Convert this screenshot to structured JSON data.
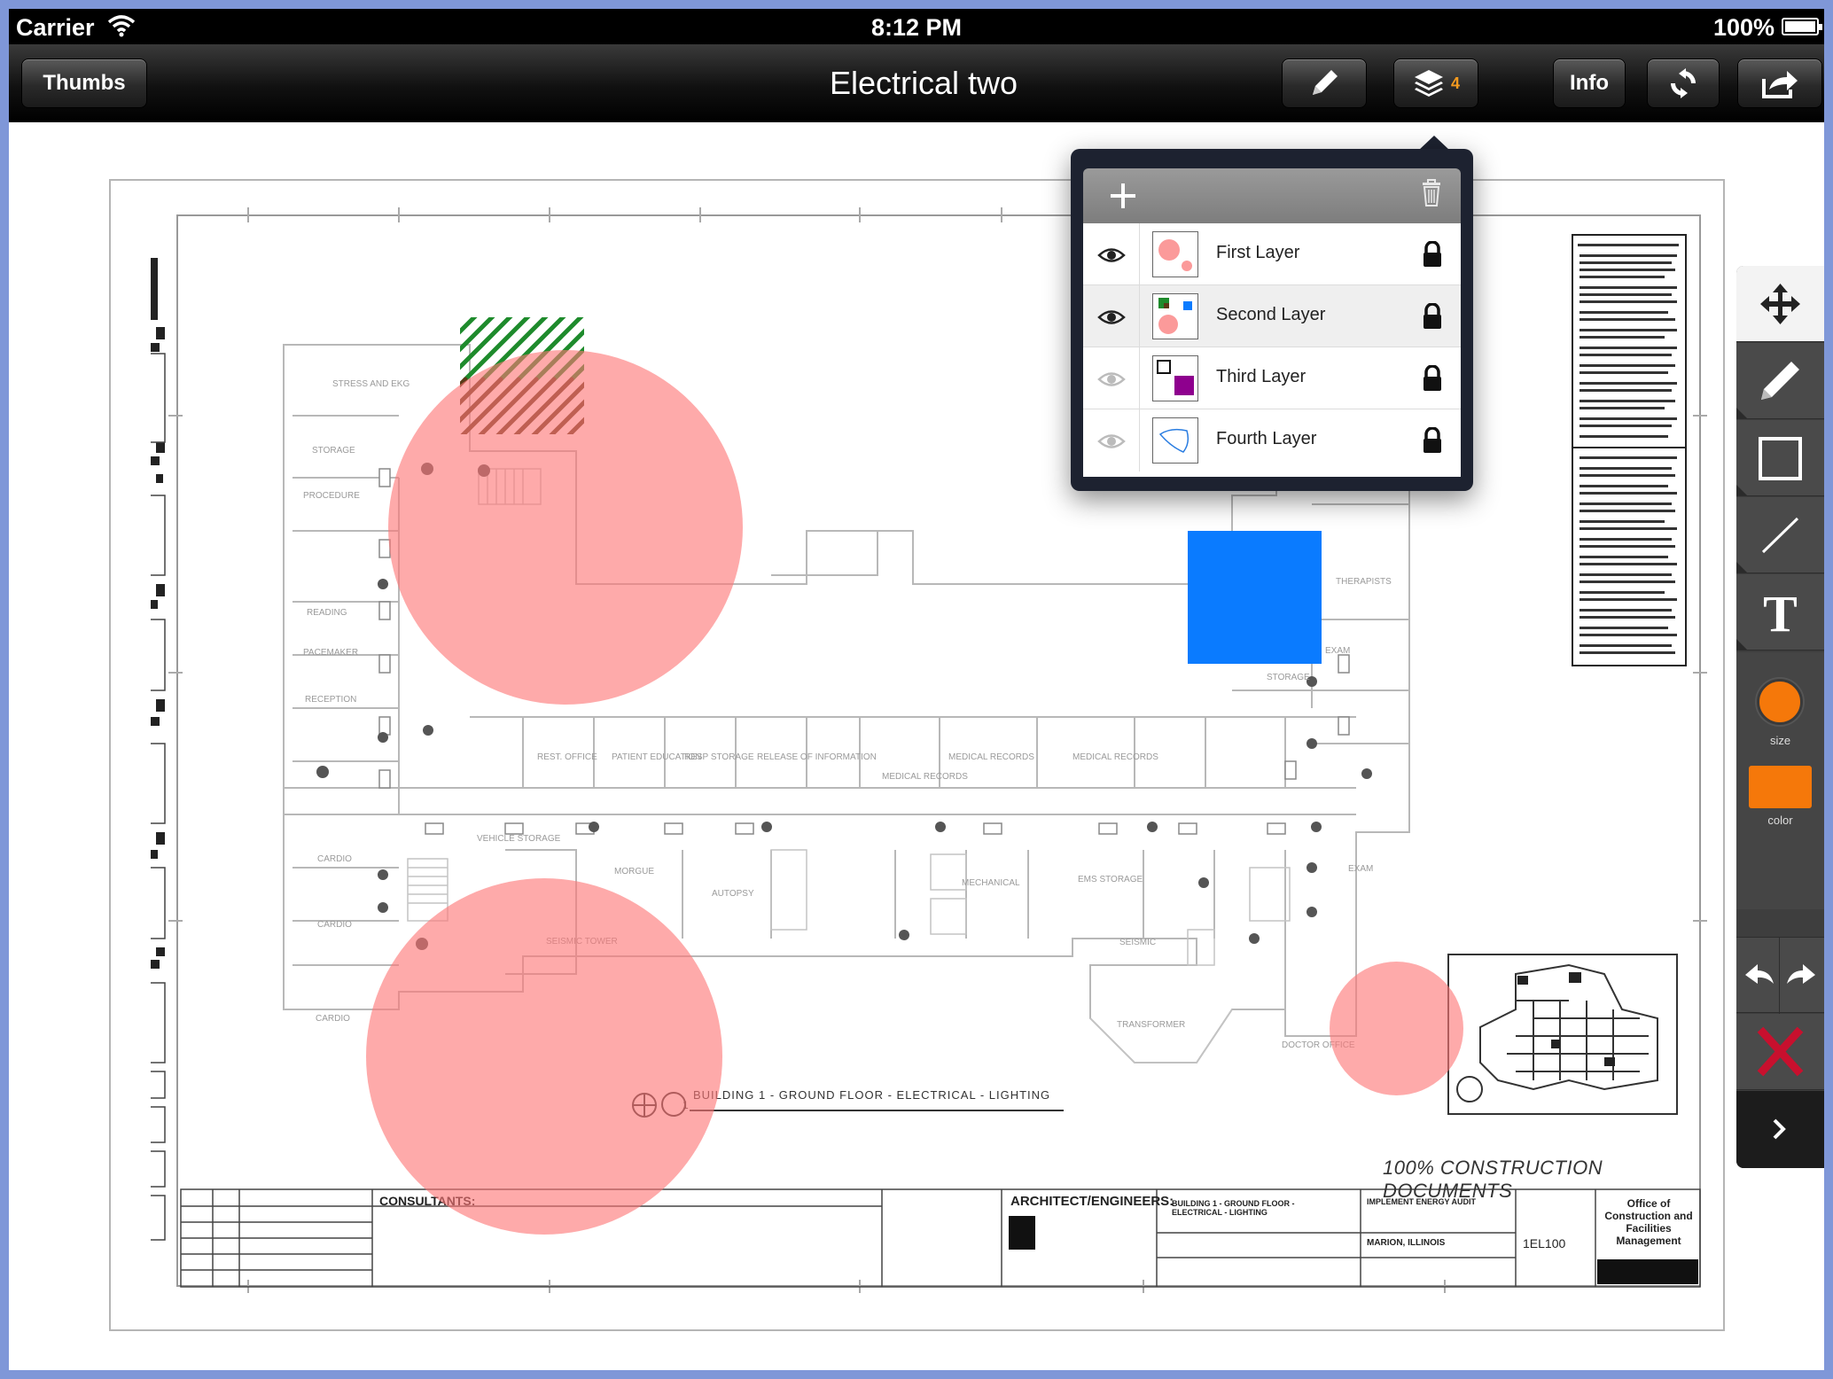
{
  "status_bar": {
    "carrier": "Carrier",
    "time": "8:12 PM",
    "battery": "100%"
  },
  "nav": {
    "left_button": "Thumbs",
    "title": "Electrical two",
    "layers_count": "4",
    "info_button": "Info"
  },
  "drawing": {
    "plan_caption": "BUILDING 1 - GROUND FLOOR - ELECTRICAL - LIGHTING",
    "documents_caption": "100% CONSTRUCTION DOCUMENTS",
    "consultants_label": "CONSULTANTS:",
    "architects_label": "ARCHITECT/ENGINEERS:",
    "office_label": "Office of Construction and Facilities Management",
    "sheet_number": "1EL100",
    "project_title": "IMPLEMENT ENERGY AUDIT",
    "drawing_title": "BUILDING 1 - GROUND FLOOR - ELECTRICAL - LIGHTING",
    "location": "MARION, ILLINOIS"
  },
  "layers_popover": {
    "add_icon": "plus-icon",
    "delete_icon": "trash-icon",
    "layers": [
      {
        "label": "First Layer",
        "visible": true,
        "locked": true,
        "selected": false
      },
      {
        "label": "Second Layer",
        "visible": true,
        "locked": true,
        "selected": true
      },
      {
        "label": "Third Layer",
        "visible": false,
        "locked": true,
        "selected": false
      },
      {
        "label": "Fourth Layer",
        "visible": false,
        "locked": true,
        "selected": false
      }
    ]
  },
  "tools": {
    "move": "move-icon",
    "pen": "pencil-icon",
    "rectangle": "rectangle-icon",
    "line": "line-icon",
    "text": "text-icon",
    "size_label": "size",
    "color_label": "color",
    "accent_color": "#f5780a",
    "undo": "undo-icon",
    "redo": "redo-icon",
    "delete": "delete-icon",
    "collapse": "chevron-right-icon"
  },
  "annotation_colors": {
    "circle_fill": "#fd7676",
    "rect_fill": "#0a7bff",
    "hatch_colors": [
      "#1e8b2c",
      "#5a3a18"
    ]
  }
}
